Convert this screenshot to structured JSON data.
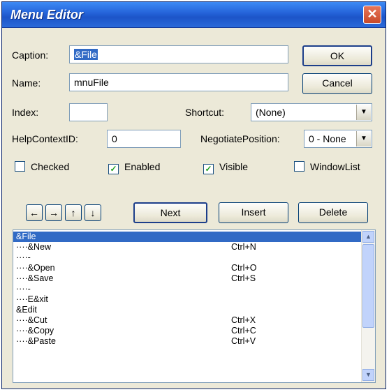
{
  "window": {
    "title": "Menu Editor",
    "close_glyph": "✕"
  },
  "caption": {
    "label": "Caption:",
    "value": "&File"
  },
  "name": {
    "label": "Name:",
    "value": "mnuFile"
  },
  "index": {
    "label": "Index:",
    "value": ""
  },
  "shortcut": {
    "label": "Shortcut:",
    "value": "(None)"
  },
  "helpcontextid": {
    "label": "HelpContextID:",
    "value": "0"
  },
  "negotiate": {
    "label": "NegotiatePosition:",
    "value": "0 - None"
  },
  "buttons": {
    "ok": "OK",
    "cancel": "Cancel",
    "next": "Next",
    "insert": "Insert",
    "delete": "Delete"
  },
  "arrows": {
    "left": "←",
    "right": "→",
    "up": "↑",
    "down": "↓"
  },
  "checkboxes": [
    {
      "label": "Checked",
      "checked": false
    },
    {
      "label": "Enabled",
      "checked": true
    },
    {
      "label": "Visible",
      "checked": true
    },
    {
      "label": "WindowList",
      "checked": false
    }
  ],
  "menu_items": [
    {
      "caption": "&File",
      "shortcut": "",
      "selected": true
    },
    {
      "caption": "····&New",
      "shortcut": "Ctrl+N",
      "selected": false
    },
    {
      "caption": "····-",
      "shortcut": "",
      "selected": false
    },
    {
      "caption": "····&Open",
      "shortcut": "Ctrl+O",
      "selected": false
    },
    {
      "caption": "····&Save",
      "shortcut": "Ctrl+S",
      "selected": false
    },
    {
      "caption": "····-",
      "shortcut": "",
      "selected": false
    },
    {
      "caption": "····E&xit",
      "shortcut": "",
      "selected": false
    },
    {
      "caption": "&Edit",
      "shortcut": "",
      "selected": false
    },
    {
      "caption": "····&Cut",
      "shortcut": "Ctrl+X",
      "selected": false
    },
    {
      "caption": "····&Copy",
      "shortcut": "Ctrl+C",
      "selected": false
    },
    {
      "caption": "····&Paste",
      "shortcut": "Ctrl+V",
      "selected": false
    }
  ]
}
